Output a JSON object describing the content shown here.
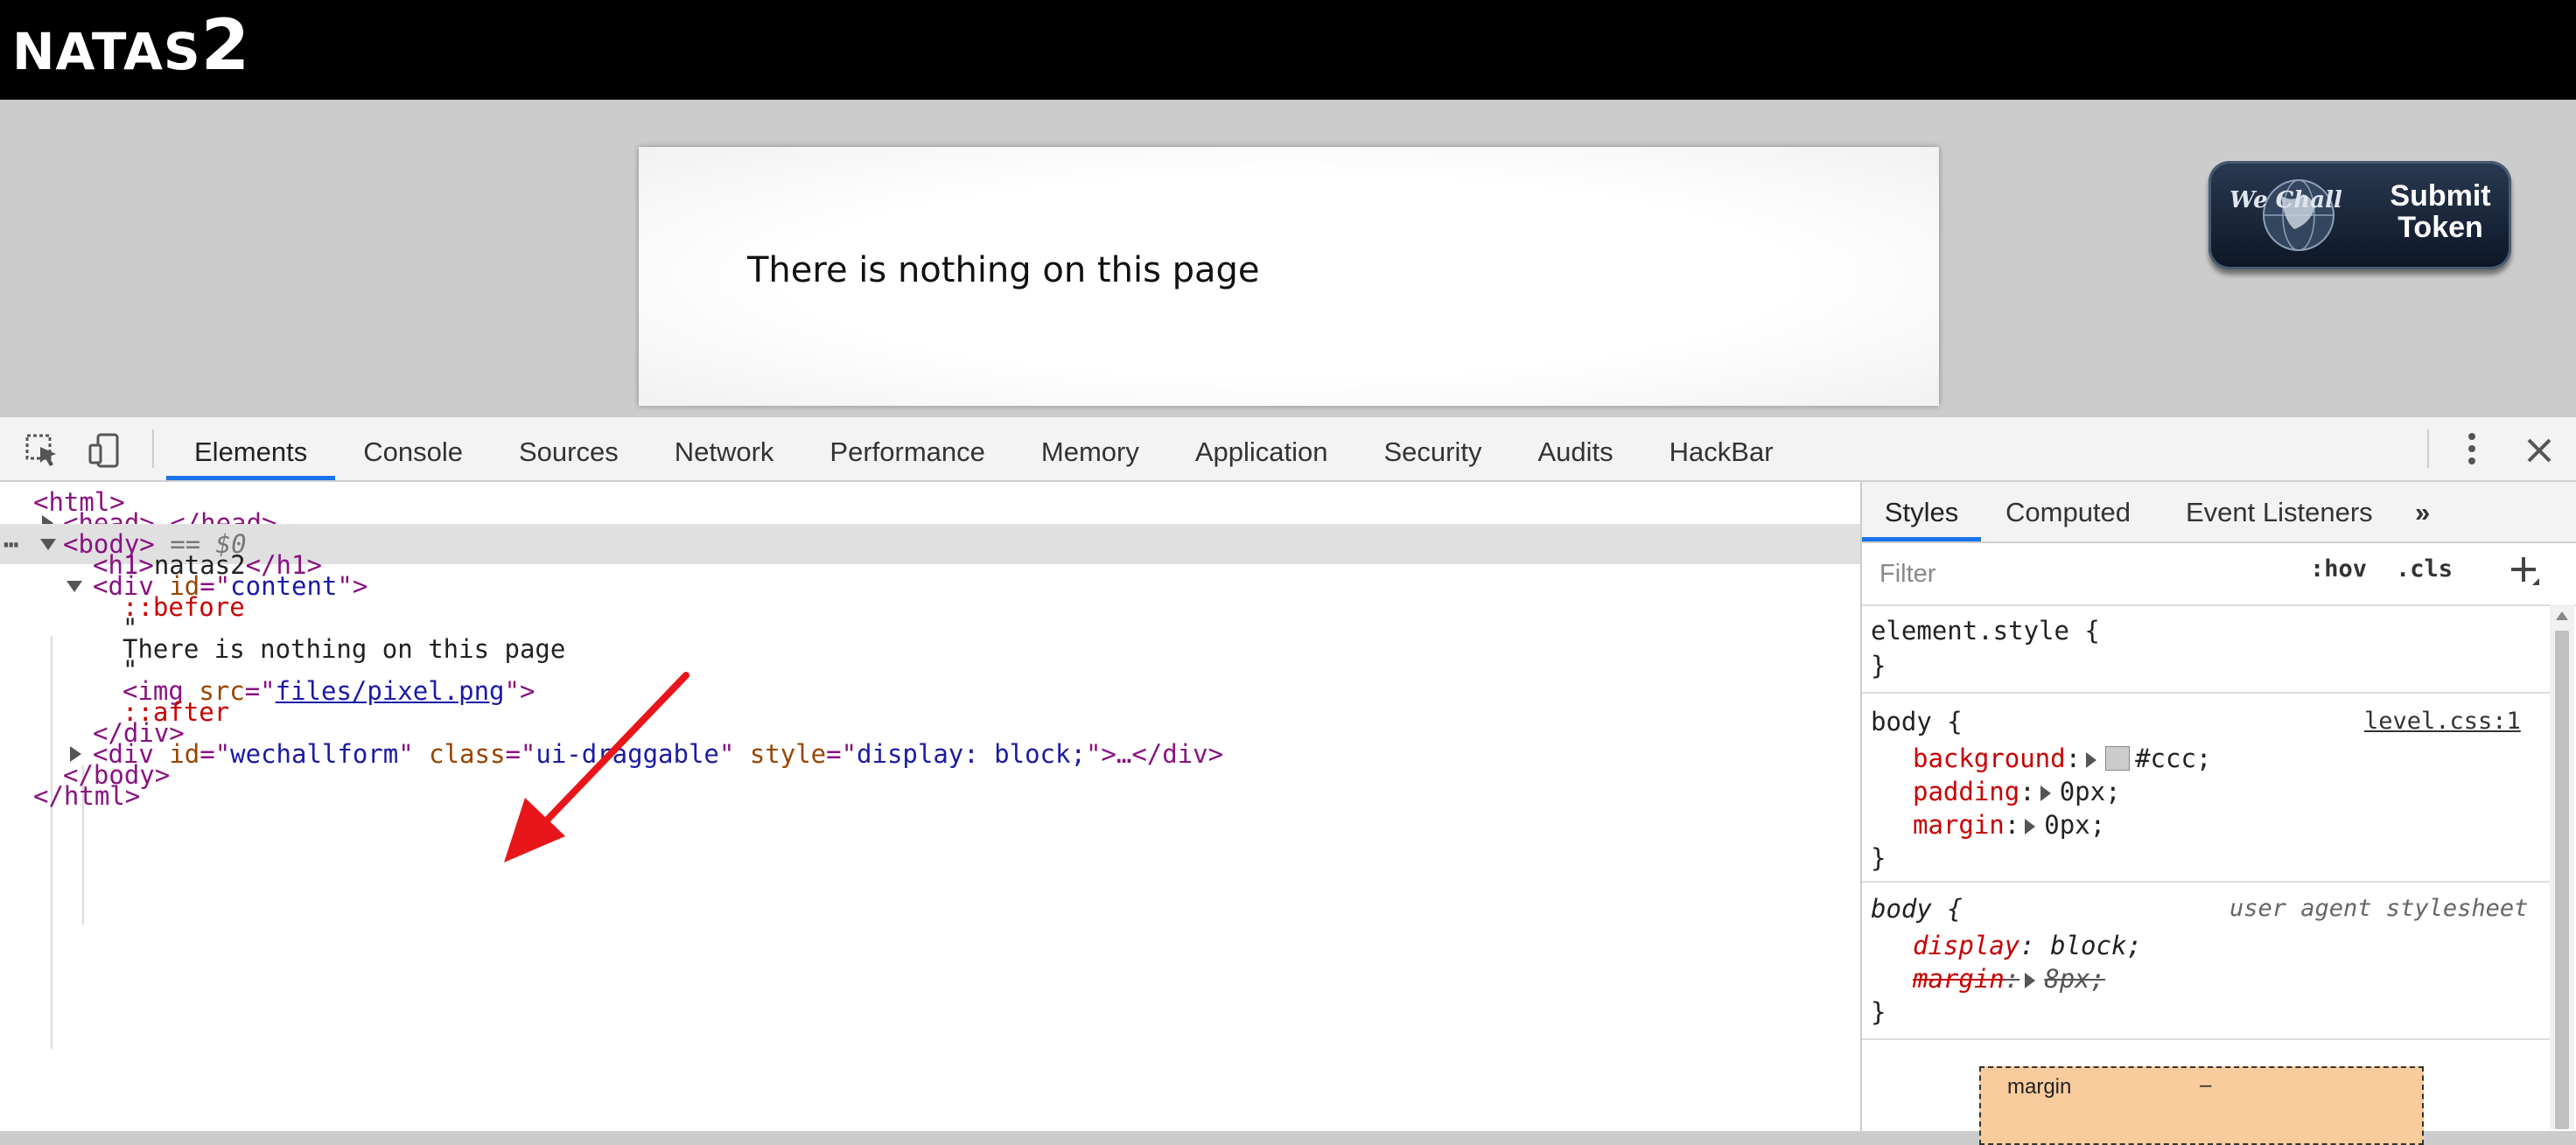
{
  "page": {
    "title_prefix": "NATAS",
    "title_suffix": "2",
    "content_text": "There is nothing on this page",
    "wechall": {
      "logo_text": "We Chall",
      "submit_line1": "Submit",
      "submit_line2": "Token"
    }
  },
  "devtools": {
    "tabs": [
      "Elements",
      "Console",
      "Sources",
      "Network",
      "Performance",
      "Memory",
      "Application",
      "Security",
      "Audits",
      "HackBar"
    ],
    "active_tab": "Elements",
    "dom": {
      "html_open": "<html>",
      "head": "<head>…</head>",
      "body_open": "<body>",
      "body_marker": " == $0",
      "h1": "natas2",
      "div_content_id": "content",
      "before": "::before",
      "quote": "\"",
      "text_node": "There is nothing on this page",
      "img_src": "files/pixel.png",
      "after": "::after",
      "div_close": "</div>",
      "wechall_div_id": "wechallform",
      "wechall_div_class": "ui-draggable",
      "wechall_div_style": "display: block;",
      "body_close": "</body>",
      "html_close": "</html>"
    },
    "sidebar": {
      "tabs": [
        "Styles",
        "Computed",
        "Event Listeners"
      ],
      "more": "»",
      "filter_placeholder": "Filter",
      "hov": ":hov",
      "cls": ".cls",
      "element_style": "element.style {",
      "close_brace": "}",
      "rule1": {
        "selector": "body {",
        "source": "level.css:1",
        "props": [
          {
            "name": "background",
            "value": "#ccc;"
          },
          {
            "name": "padding",
            "value": "0px;"
          },
          {
            "name": "margin",
            "value": "0px;"
          }
        ]
      },
      "rule2": {
        "selector": "body {",
        "source": "user agent stylesheet",
        "props": [
          {
            "name": "display",
            "value": "block;"
          },
          {
            "name": "margin",
            "value": "8px;"
          }
        ]
      },
      "box_model_label": "margin",
      "box_model_value": "–"
    }
  }
}
